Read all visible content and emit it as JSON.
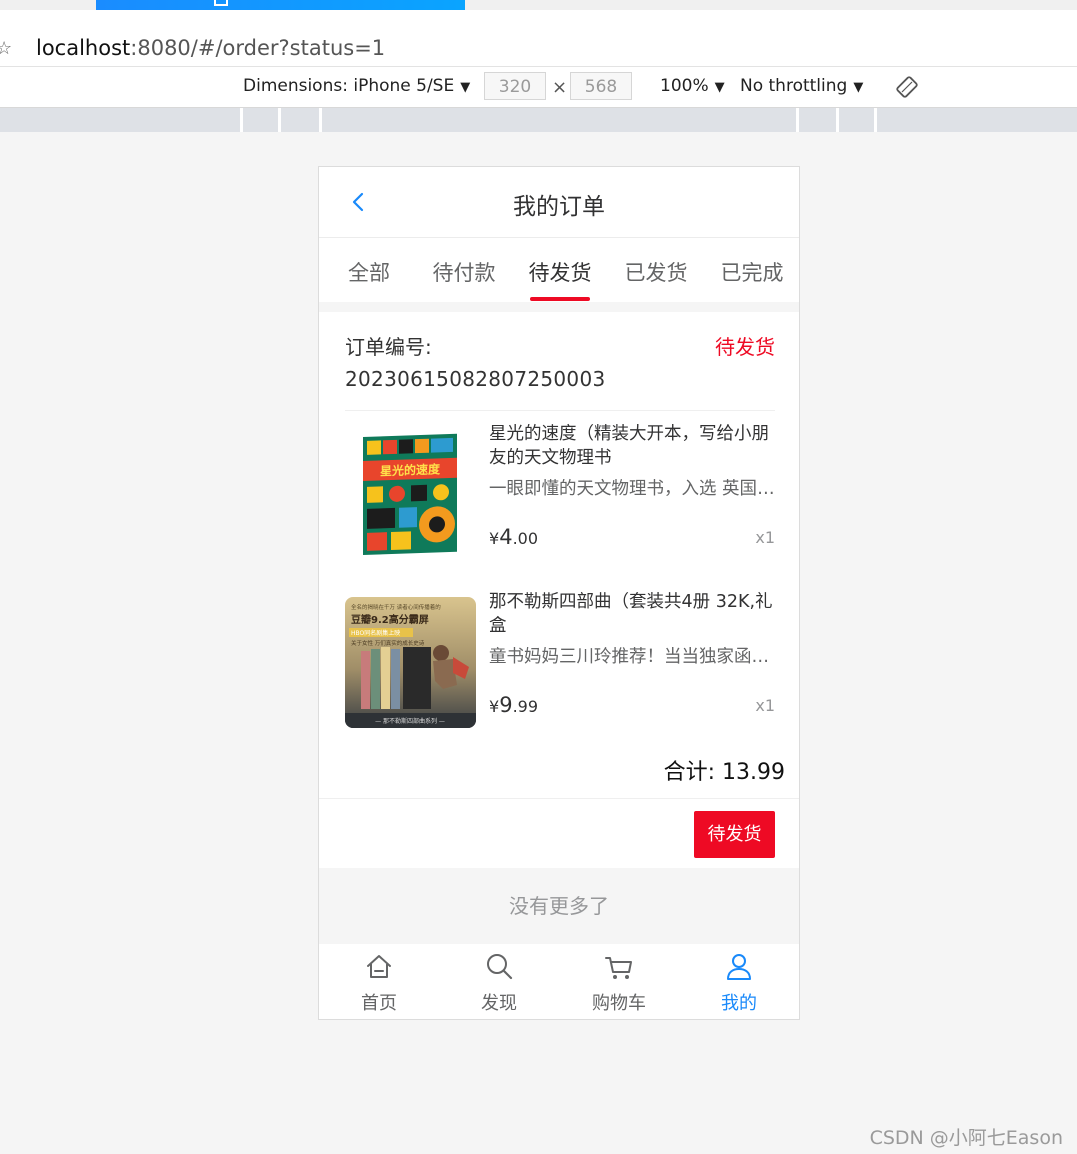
{
  "browser": {
    "url_host": "localhost",
    "url_rest": ":8080/#/order?status=1"
  },
  "devtools": {
    "dimensions_label": "Dimensions: iPhone 5/SE",
    "width_value": "320",
    "height_value": "568",
    "times": "×",
    "zoom": "100%",
    "throttling": "No throttling"
  },
  "app": {
    "title": "我的订单",
    "tabs": [
      "全部",
      "待付款",
      "待发货",
      "已发货",
      "已完成"
    ],
    "active_tab": 2,
    "order": {
      "number_label": "订单编号:",
      "number": "20230615082807250003",
      "status": "待发货",
      "items": [
        {
          "title": "星光的速度（精装大开本，写给小朋友的天文物理书",
          "desc": "一眼即懂的天文物理书，入选 英国皇家学会青少年科学图书奖",
          "price_currency": "¥",
          "price_int": "4",
          "price_dec": ".00",
          "qty": "x1",
          "cover_text": "星光的速度"
        },
        {
          "title": "那不勒斯四部曲（套装共4册 32K,礼盒",
          "desc": "童书妈妈三川玲推荐！当当独家函套装",
          "price_currency": "¥",
          "price_int": "9",
          "price_dec": ".99",
          "qty": "x1",
          "cover_lines": [
            "全名的揭晓在千万 读者心间传播着的",
            "豆瓣9.2高分霸屏",
            "HBO同名剧集上映",
            "关于女性 万们真实的成长史诗",
            "— 那不勒斯四部曲系列 —"
          ]
        }
      ],
      "total": "合计: 13.99",
      "action_label": "待发货"
    },
    "no_more": "没有更多了",
    "tabbar": [
      {
        "label": "首页",
        "icon": "home-icon"
      },
      {
        "label": "发现",
        "icon": "search-icon"
      },
      {
        "label": "购物车",
        "icon": "cart-icon"
      },
      {
        "label": "我的",
        "icon": "user-icon"
      }
    ],
    "colors": {
      "accent_red": "#ee0a24",
      "active_blue": "#1989fa"
    }
  },
  "watermark": "CSDN @小阿七Eason"
}
